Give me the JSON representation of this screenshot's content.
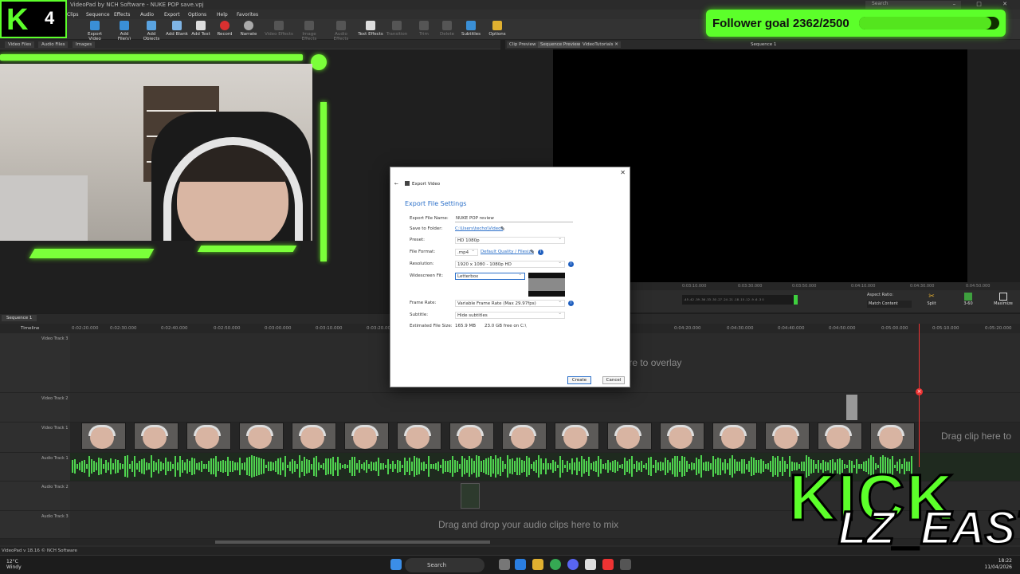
{
  "window": {
    "title": "VideoPad by NCH Software - NUKE POP save.vpj",
    "search_placeholder": "Search",
    "controls": "–  □  ✕"
  },
  "menu": [
    "Clips",
    "Sequence",
    "Effects",
    "Audio",
    "Export",
    "Options",
    "Help",
    "Favorites"
  ],
  "toolbar": [
    {
      "label": "Export Video",
      "icon": "export-video-icon"
    },
    {
      "label": "Add File(s)",
      "icon": "add-files-icon"
    },
    {
      "label": "Add Objects",
      "icon": "add-objects-icon"
    },
    {
      "label": "Add Blank",
      "icon": "add-blank-icon"
    },
    {
      "label": "Add Text",
      "icon": "add-text-icon"
    },
    {
      "label": "Record",
      "icon": "record-icon"
    },
    {
      "label": "Narrate",
      "icon": "narrate-icon"
    },
    {
      "label": "Video Effects",
      "icon": "video-effects-icon"
    },
    {
      "label": "Image Effects",
      "icon": "image-effects-icon"
    },
    {
      "label": "Audio Effects",
      "icon": "audio-effects-icon"
    },
    {
      "label": "Text Effects",
      "icon": "text-effects-icon"
    },
    {
      "label": "Transition",
      "icon": "transition-icon"
    },
    {
      "label": "Trim",
      "icon": "trim-icon"
    },
    {
      "label": "Delete",
      "icon": "delete-icon"
    },
    {
      "label": "Subtitles",
      "icon": "subtitles-icon"
    },
    {
      "label": "Options",
      "icon": "options-icon"
    }
  ],
  "bin_tabs": [
    "Video Files",
    "Audio Files",
    "Images"
  ],
  "preview_tabs": [
    "Clip Preview",
    "Sequence Preview",
    "VideoTutorials ✕"
  ],
  "sequence_label": "Sequence 1",
  "preview_ruler": [
    "0:03:10.000",
    "0:03:30.000",
    "0:03:50.000",
    "0:04:10.000",
    "0:04:30.000",
    "0:04:50.000"
  ],
  "meter_scale": "-45 -42 -39 -36 -33 -30 -27 -24 -21 -18 -15 -12 -9 -6 -3 0",
  "aspect": {
    "label": "Aspect Ratio:",
    "value": "Match Content"
  },
  "preview_buttons": [
    {
      "label": "Split",
      "icon": "split-icon"
    },
    {
      "label": "3-60",
      "icon": "3d-icon"
    },
    {
      "label": "Maximize",
      "icon": "maximize-icon"
    }
  ],
  "goal": {
    "label": "Follower goal 2362/2500",
    "current": 2362,
    "target": 2500
  },
  "logo": {
    "letter": "K",
    "number": "4"
  },
  "timeline": {
    "tab": "Sequence 1",
    "ruler_label": "Timeline",
    "ruler": [
      "0:02:20.000",
      "0:02:30.000",
      "0:02:40.000",
      "0:02:50.000",
      "0:03:00.000",
      "0:03:10.000",
      "0:03:20.000",
      "0:04:20.000",
      "0:04:30.000",
      "0:04:40.000",
      "0:04:50.000",
      "0:05:00.000",
      "0:05:10.000",
      "0:05:20.000"
    ],
    "tracks": [
      "Video Track 3",
      "Video Track 2",
      "Video Track 1",
      "Audio Track 1",
      "Audio Track 2",
      "Audio Track 3"
    ],
    "overlay_hint": "here to overlay",
    "drag_clip_hint": "Drag clip here to",
    "audio_hint": "Drag and drop your audio clips here to mix"
  },
  "status": "VideoPad v 18.16 © NCH Software",
  "dialog": {
    "title": "Export Video",
    "heading": "Export File Settings",
    "fields": {
      "file_name_label": "Export File Name:",
      "file_name": "NUKE POP review",
      "folder_label": "Save to Folder:",
      "folder": "C:\\Users\\techo\\Videos",
      "preset_label": "Preset:",
      "preset": "HD 1080p",
      "format_label": "File Format:",
      "format": ".mp4",
      "format_link": "Default Quality / Filesize",
      "resolution_label": "Resolution:",
      "resolution": "1920 x 1080 - 1080p HD",
      "fit_label": "Widescreen Fit:",
      "fit": "Letterbox",
      "framerate_label": "Frame Rate:",
      "framerate": "Variable Frame Rate (Max 29.97fps)",
      "subtitle_label": "Subtitle:",
      "subtitle": "Hide subtitles",
      "size_label": "Estimated File Size:",
      "size": "165.9 MB",
      "free": "23.0 GB free on C:\\"
    },
    "create": "Create",
    "cancel": "Cancel"
  },
  "overlay": {
    "brand": "KICK",
    "handle": "LZ_EAST"
  },
  "taskbar": {
    "temp": "12°C",
    "weather": "Windy",
    "search": "Search",
    "time": "18:22",
    "date": "11/04/2026"
  }
}
